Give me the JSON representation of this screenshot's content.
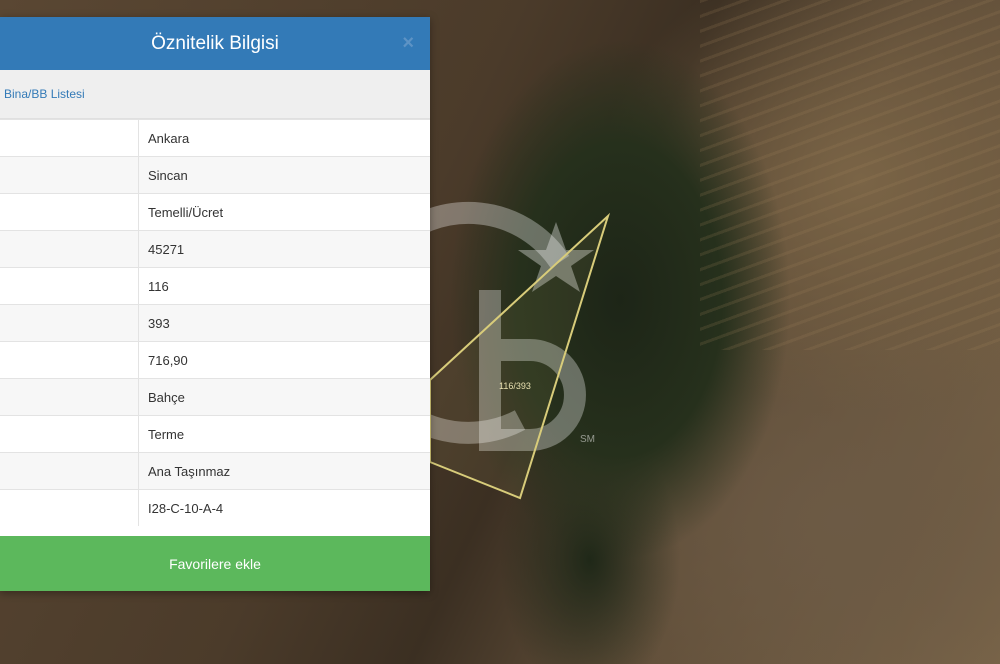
{
  "dialog": {
    "title": "Öznitelik Bilgisi",
    "close_symbol": "×",
    "list_link": "Bina/BB Listesi",
    "rows": [
      {
        "label": "",
        "value": "Ankara"
      },
      {
        "label": "",
        "value": "Sincan"
      },
      {
        "label": "",
        "value": "Temelli/Ücret"
      },
      {
        "label": "",
        "value": "45271"
      },
      {
        "label": "",
        "value": "116"
      },
      {
        "label": "",
        "value": "393"
      },
      {
        "label": "",
        "value": "716,90"
      },
      {
        "label": "",
        "value": "Bahçe"
      },
      {
        "label": "",
        "value": "Terme"
      },
      {
        "label": "",
        "value": "Ana Taşınmaz"
      },
      {
        "label": "",
        "value": "I28-C-10-A-4"
      }
    ],
    "favorite_button": "Favorilere ekle"
  },
  "map": {
    "parcel_label": "116/393",
    "watermark": {
      "letters": "CB",
      "mark": "SM"
    },
    "parcel_color": "#d8cc7a"
  },
  "colors": {
    "header": "#337ab7",
    "button": "#5cb85c"
  }
}
